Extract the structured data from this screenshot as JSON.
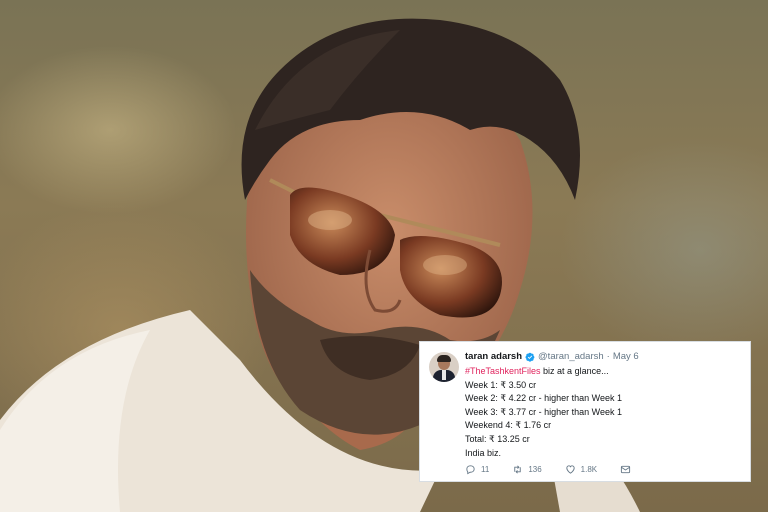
{
  "tweet": {
    "name": "taran adarsh",
    "handle": "@taran_adarsh",
    "separator": "·",
    "date": "May 6",
    "hashtag": "#TheTashkentFiles",
    "intro_rest": " biz at a glance...",
    "lines": [
      "Week 1: ₹ 3.50 cr",
      "Week 2: ₹ 4.22 cr - higher than Week 1",
      "Week 3: ₹ 3.77 cr - higher than Week 1",
      "Weekend 4: ₹ 1.76 cr",
      "Total: ₹ 13.25 cr",
      "India biz."
    ],
    "actions": {
      "replies": "11",
      "retweets": "136",
      "likes": "1.8K"
    },
    "icons": [
      "verified-badge-icon",
      "reply-icon",
      "retweet-icon",
      "like-icon",
      "direct-message-icon"
    ],
    "colors": {
      "hashtag": "#e0245e",
      "verified": "#1da1f2",
      "muted": "#657786"
    }
  }
}
